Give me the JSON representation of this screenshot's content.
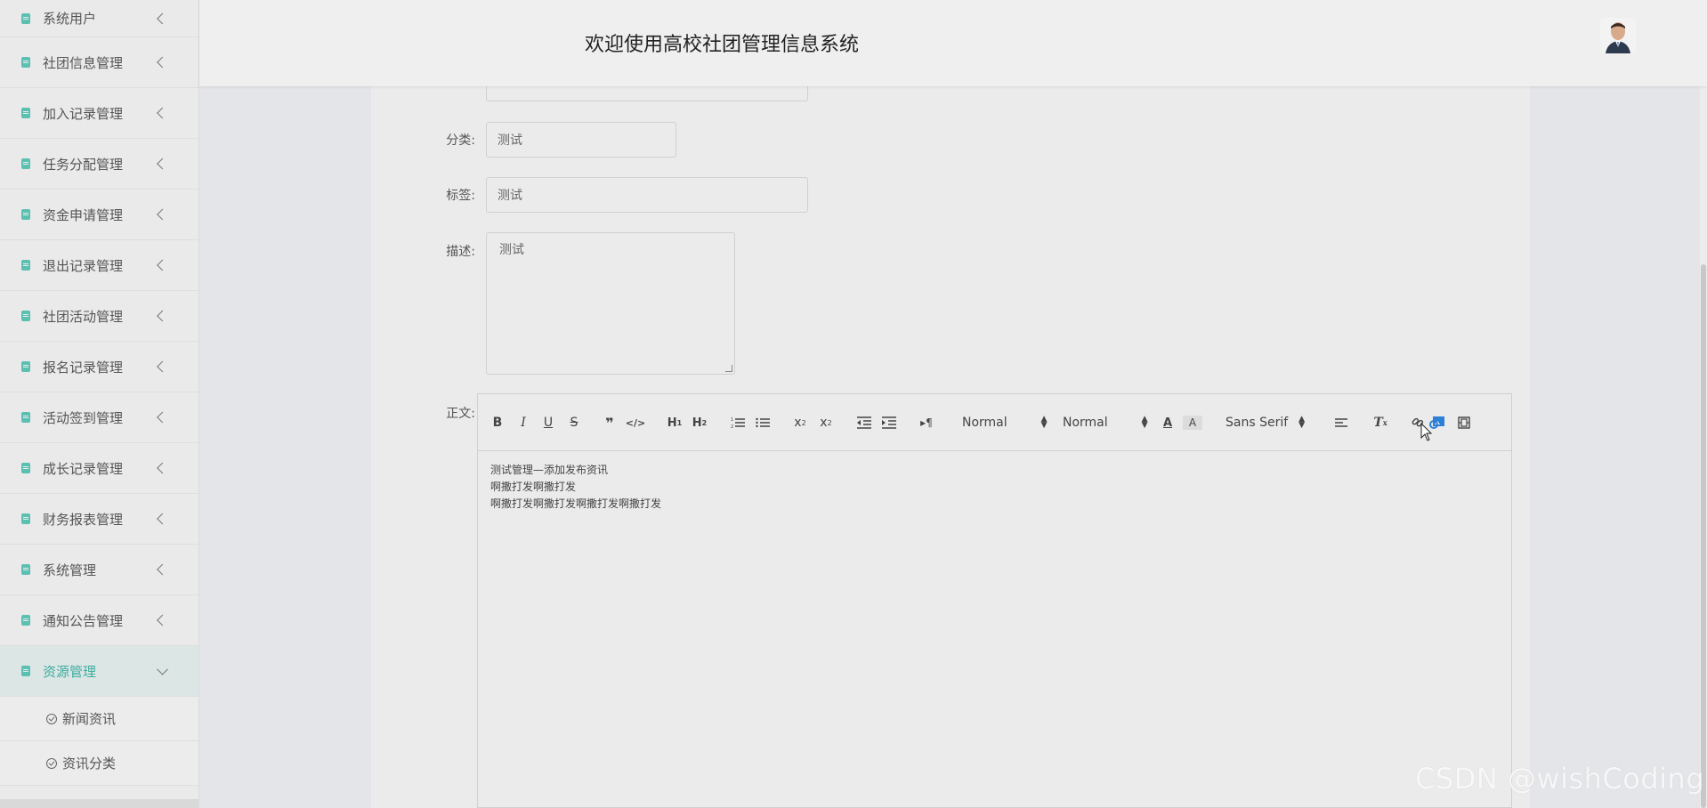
{
  "header": {
    "title": "欢迎使用高校社团管理信息系统"
  },
  "sidebar": {
    "items": [
      {
        "label": "系统用户"
      },
      {
        "label": "社团信息管理"
      },
      {
        "label": "加入记录管理"
      },
      {
        "label": "任务分配管理"
      },
      {
        "label": "资金申请管理"
      },
      {
        "label": "退出记录管理"
      },
      {
        "label": "社团活动管理"
      },
      {
        "label": "报名记录管理"
      },
      {
        "label": "活动签到管理"
      },
      {
        "label": "成长记录管理"
      },
      {
        "label": "财务报表管理"
      },
      {
        "label": "系统管理"
      },
      {
        "label": "通知公告管理"
      },
      {
        "label": "资源管理"
      }
    ],
    "sub_items": [
      {
        "label": "新闻资讯"
      },
      {
        "label": "资讯分类"
      }
    ]
  },
  "form": {
    "category": {
      "label": "分类:",
      "value": "测试"
    },
    "tags": {
      "label": "标签:",
      "value": "测试"
    },
    "description": {
      "label": "描述:",
      "value": "测试"
    },
    "body": {
      "label": "正文:"
    }
  },
  "editor": {
    "header_picker": "Normal",
    "size_picker": "Normal",
    "font_picker": "Sans Serif",
    "content": [
      "测试管理—添加发布资讯",
      "啊撒打发啊撒打发",
      "啊撒打发啊撒打发啊撒打发啊撒打发"
    ]
  },
  "watermark": "CSDN @wishCoding",
  "colors": {
    "accent": "#3eaea0",
    "icon": "#5bbfb2"
  }
}
